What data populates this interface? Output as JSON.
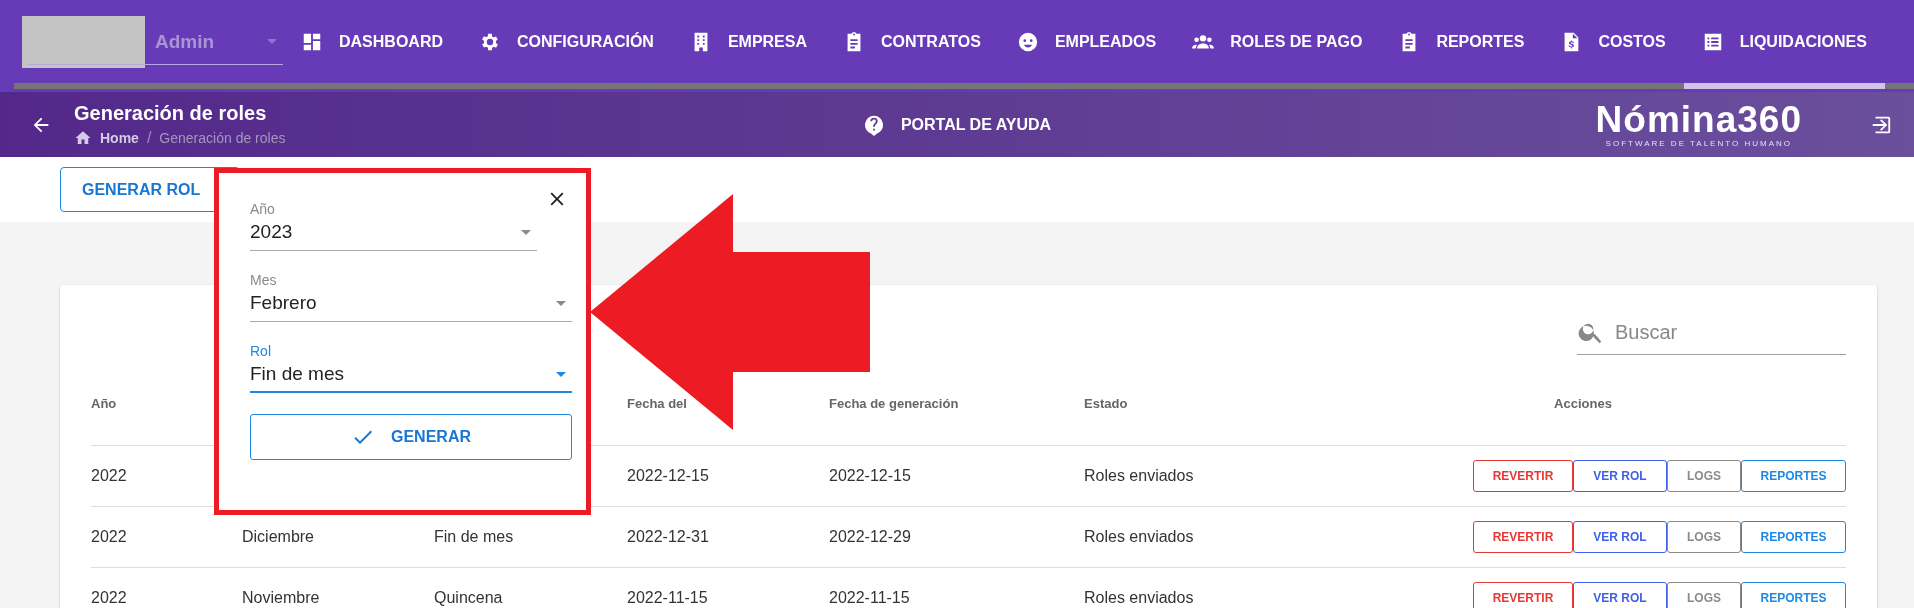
{
  "top_nav": {
    "user": {
      "name": "Admin"
    },
    "tabs": [
      {
        "label": "DASHBOARD",
        "selected": false
      },
      {
        "label": "CONFIGURACIÓN",
        "selected": false
      },
      {
        "label": "EMPRESA",
        "selected": false
      },
      {
        "label": "CONTRATOS",
        "selected": false
      },
      {
        "label": "EMPLEADOS",
        "selected": false
      },
      {
        "label": "ROLES DE PAGO",
        "selected": false
      },
      {
        "label": "REPORTES",
        "selected": false
      },
      {
        "label": "COSTOS",
        "selected": false
      },
      {
        "label": "LIQUIDACIONES",
        "selected": true
      }
    ]
  },
  "page_header": {
    "title": "Generación de roles",
    "breadcrumb": {
      "items": [
        "Home",
        "Generación de roles"
      ],
      "separator": "/"
    },
    "help_link": "PORTAL DE AYUDA",
    "logo": {
      "name": "Nómina360",
      "tagline": "SOFTWARE DE TALENTO HUMANO"
    }
  },
  "toolbar": {
    "generate_button": "GENERAR ROL"
  },
  "dialog": {
    "fields": [
      {
        "label": "Año",
        "value": "2023",
        "focused": false
      },
      {
        "label": "Mes",
        "value": "Febrero",
        "focused": false
      },
      {
        "label": "Rol",
        "value": "Fin de mes",
        "focused": true
      }
    ],
    "submit": "GENERAR"
  },
  "table": {
    "search": {
      "placeholder": "Buscar"
    },
    "columns": [
      {
        "label": "Año"
      },
      {},
      {},
      {
        "label": "Fecha del"
      },
      {
        "label": "Fecha de generación"
      },
      {
        "label": "Estado"
      },
      {
        "label": "Acciones"
      }
    ],
    "rows": [
      {
        "cells": [
          "2022",
          null,
          null,
          "2022-12-15",
          "2022-12-15",
          "Roles enviados"
        ],
        "actions": [
          {
            "label": "REVERTIR",
            "kind": "danger"
          },
          {
            "label": "VER ROL",
            "kind": "primary"
          },
          {
            "label": "LOGS",
            "kind": "neutral"
          },
          {
            "label": "REPORTES",
            "kind": "info"
          }
        ]
      },
      {
        "cells": [
          "2022",
          "Diciembre",
          "Fin de mes",
          "2022-12-31",
          "2022-12-29",
          "Roles enviados"
        ],
        "actions": [
          {
            "label": "REVERTIR",
            "kind": "danger"
          },
          {
            "label": "VER ROL",
            "kind": "primary"
          },
          {
            "label": "LOGS",
            "kind": "neutral"
          },
          {
            "label": "REPORTES",
            "kind": "info"
          }
        ]
      },
      {
        "cells": [
          "2022",
          "Noviembre",
          "Quincena",
          "2022-11-15",
          "2022-11-15",
          "Roles enviados"
        ],
        "actions": [
          {
            "label": "REVERTIR",
            "kind": "danger"
          },
          {
            "label": "VER ROL",
            "kind": "primary"
          },
          {
            "label": "LOGS",
            "kind": "neutral"
          },
          {
            "label": "REPORTES",
            "kind": "info"
          }
        ]
      }
    ]
  }
}
